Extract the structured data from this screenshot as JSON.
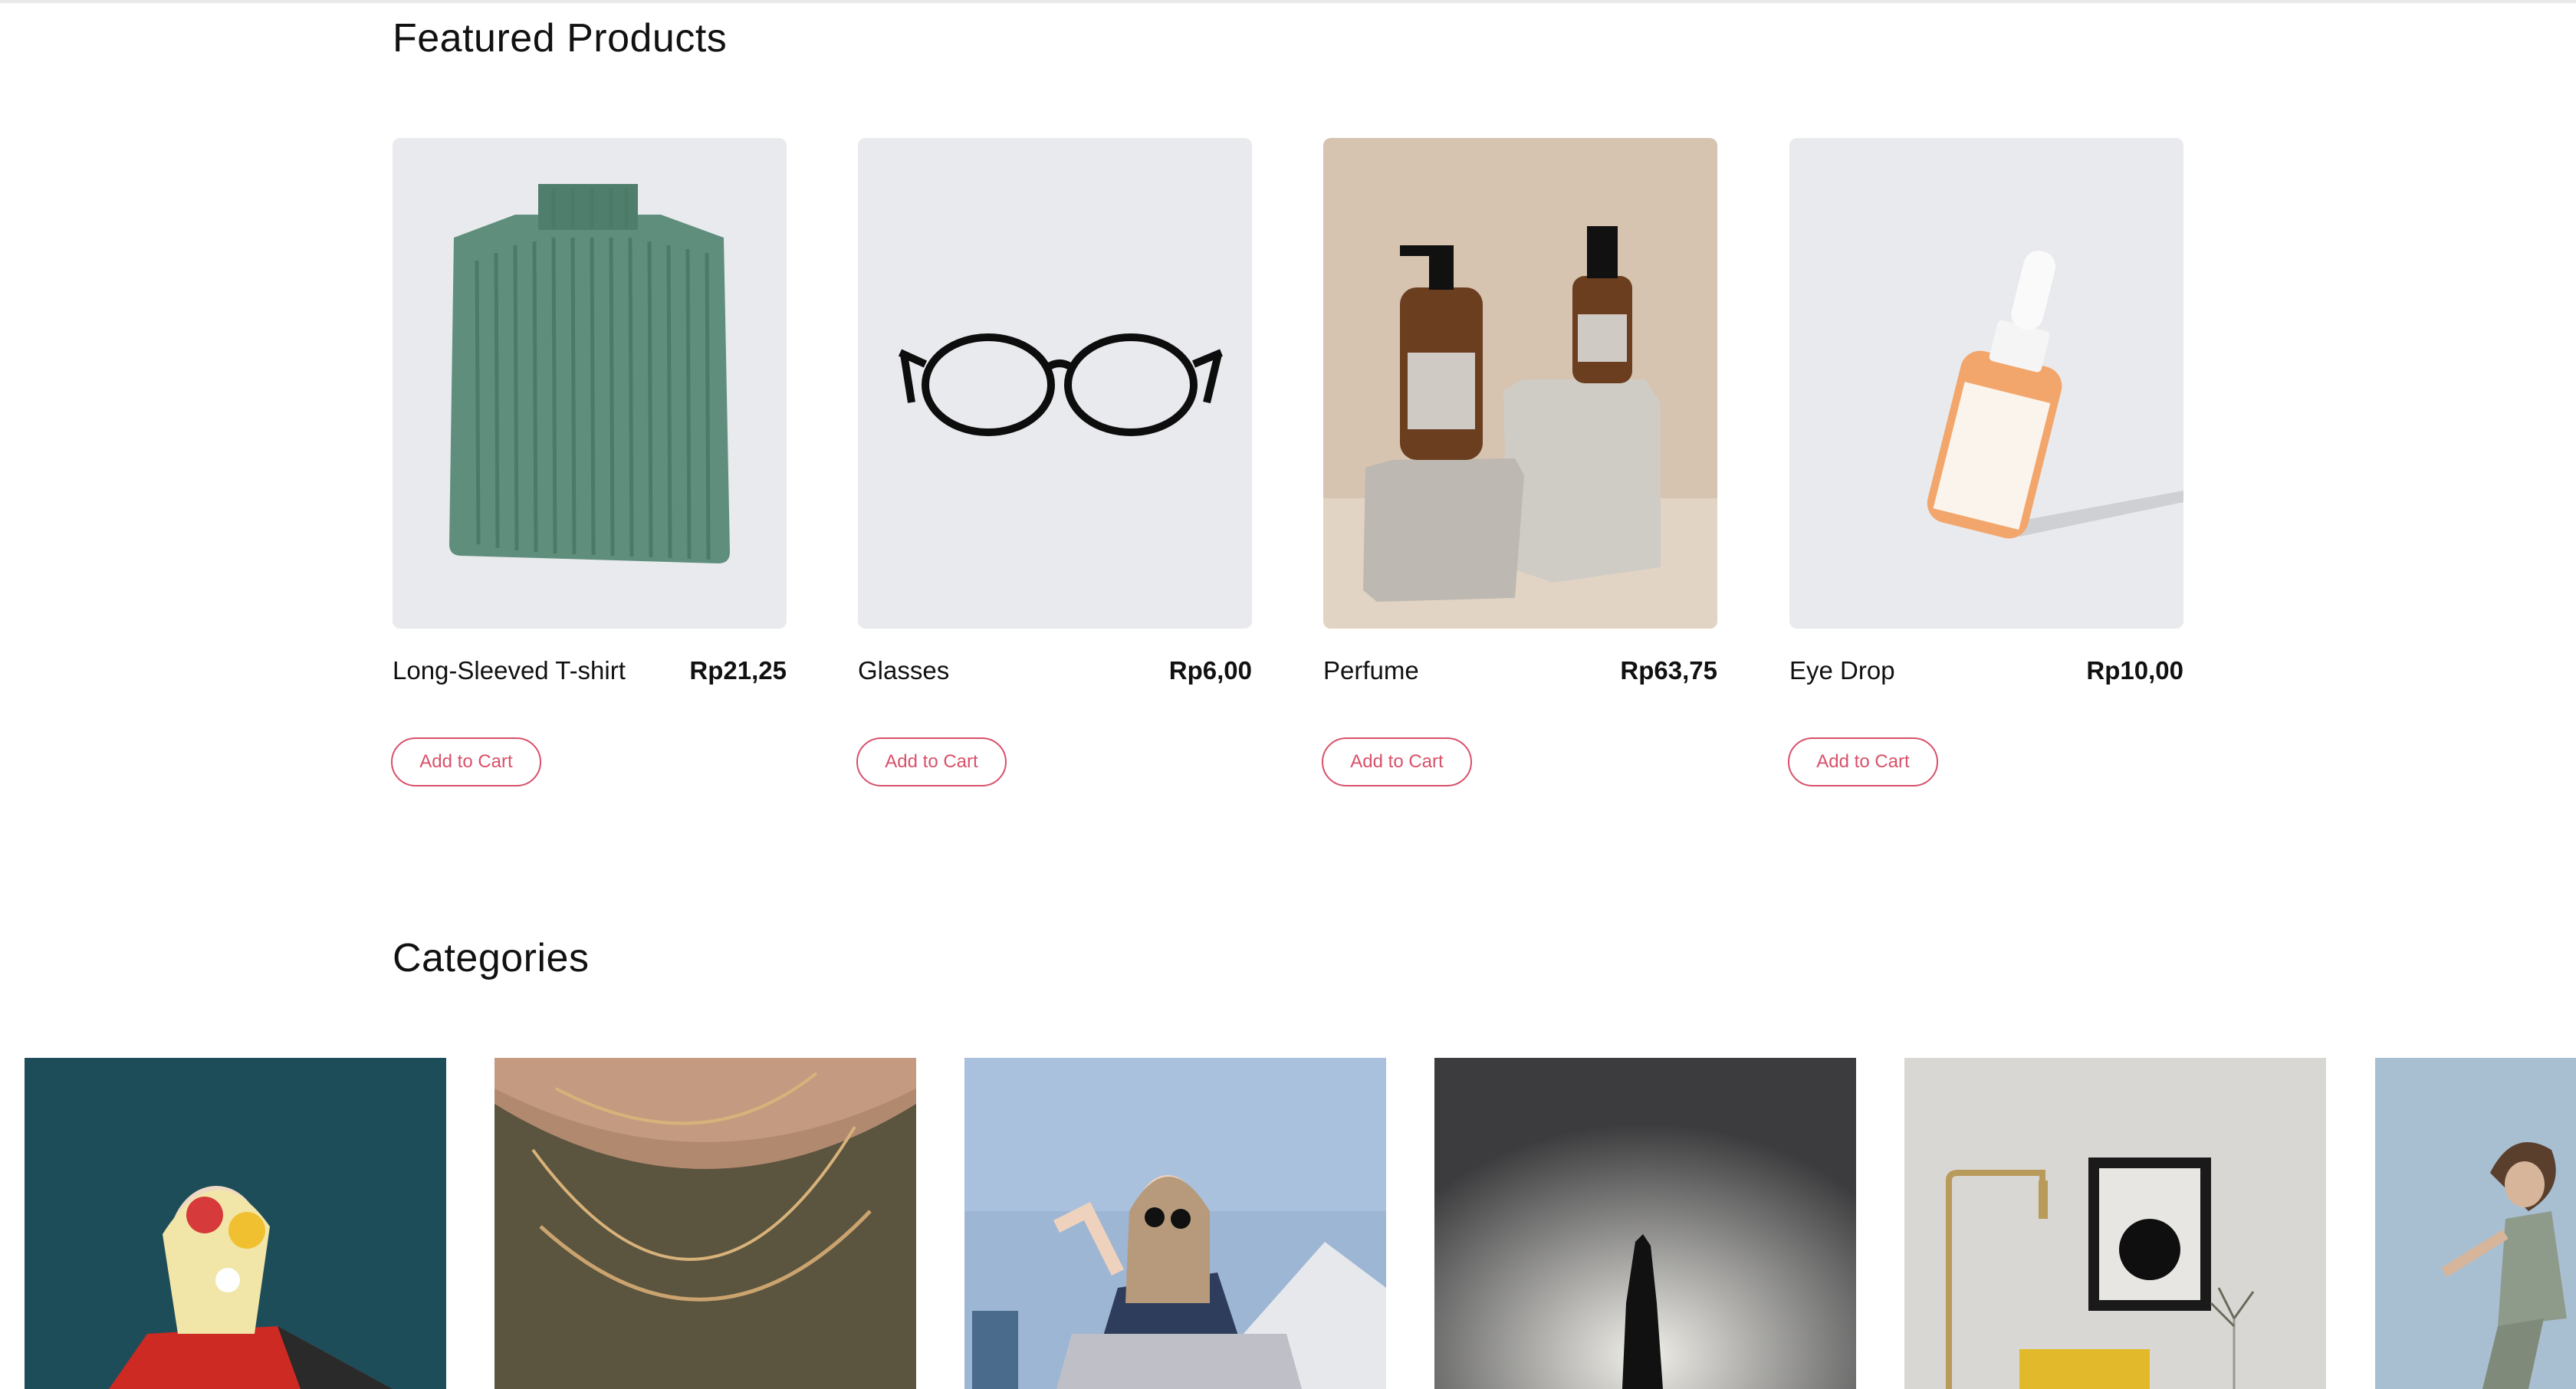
{
  "featured": {
    "title": "Featured Products",
    "products": [
      {
        "name": "Long-Sleeved T-shirt",
        "price": "Rp21,25",
        "button": "Add to Cart",
        "image": "green-knit-turtleneck-sweater"
      },
      {
        "name": "Glasses",
        "price": "Rp6,00",
        "button": "Add to Cart",
        "image": "black-round-eyeglasses"
      },
      {
        "name": "Perfume",
        "price": "Rp63,75",
        "button": "Add to Cart",
        "image": "amber-perfume-bottles-on-stone"
      },
      {
        "name": "Eye Drop",
        "price": "Rp10,00",
        "button": "Add to Cart",
        "image": "orange-dropper-bottle"
      }
    ]
  },
  "categories": {
    "title": "Categories",
    "items": [
      {
        "image": "woman-with-flower-sunglasses"
      },
      {
        "image": "gold-necklaces"
      },
      {
        "image": "woman-in-sunglasses-sitting"
      },
      {
        "image": "silhouette-handstand"
      },
      {
        "image": "minimal-interior-with-lamp"
      },
      {
        "image": "woman-jumping"
      }
    ]
  },
  "colors": {
    "accent": "#d9506a",
    "product_bg": "#e9eaee",
    "text": "#111111"
  }
}
